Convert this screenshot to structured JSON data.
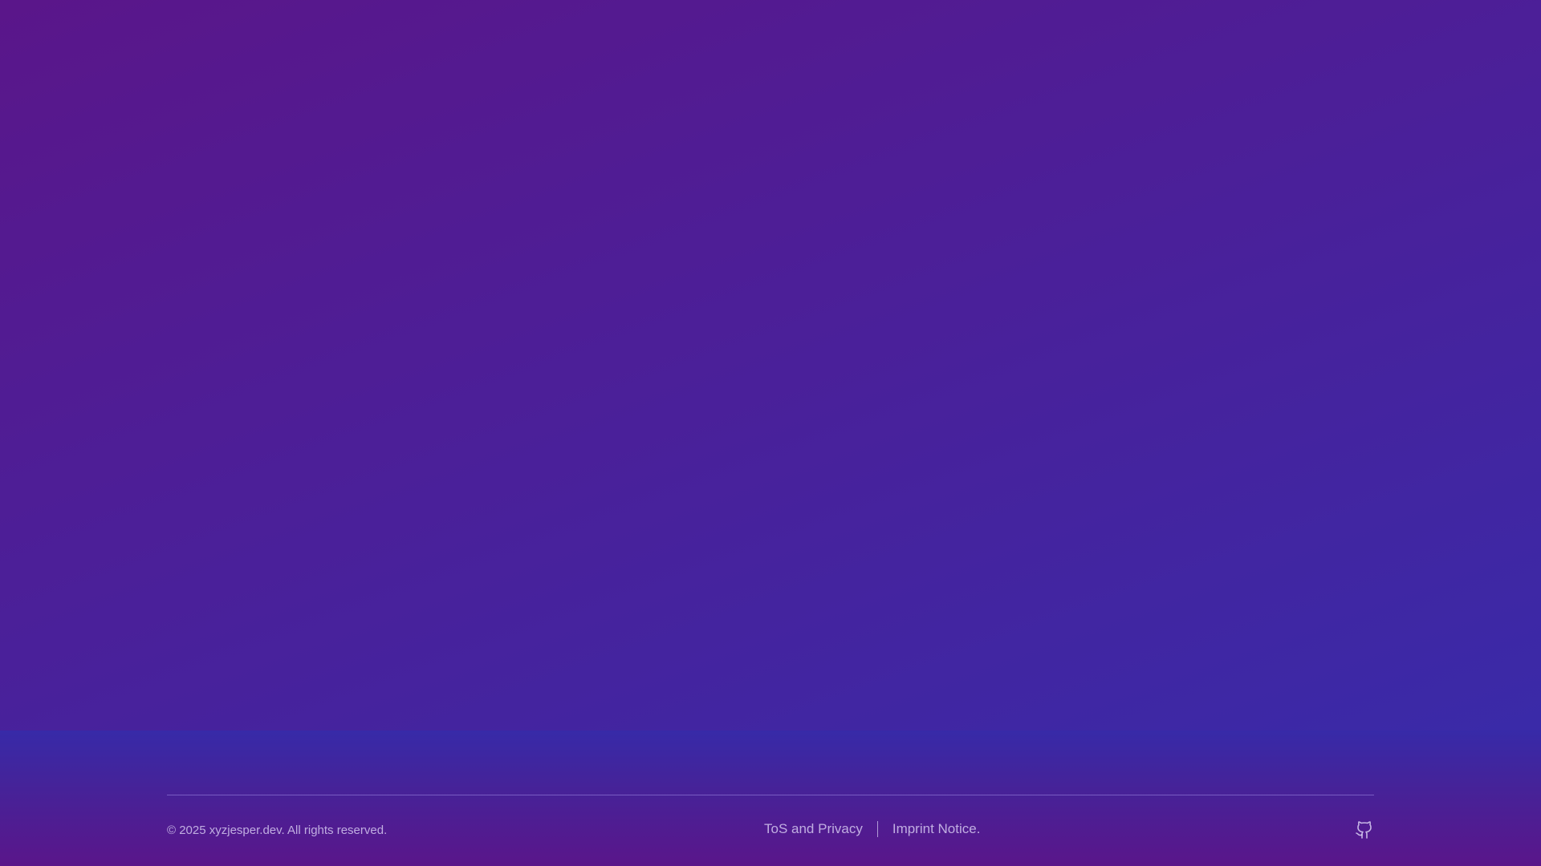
{
  "footer": {
    "copyright": "© 2025 xyzjesper.dev. All rights reserved.",
    "links": [
      {
        "label": "ToS and Privacy"
      },
      {
        "label": "Imprint Notice."
      }
    ],
    "social_icon": "github-icon"
  },
  "colors": {
    "gradient_start": "#5a168a",
    "gradient_end": "#3a2aa8"
  }
}
